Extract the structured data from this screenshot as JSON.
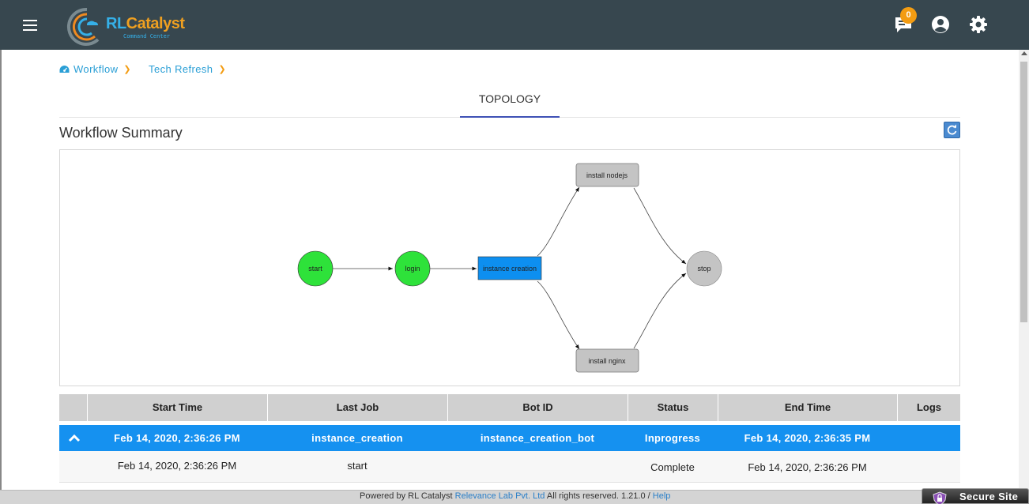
{
  "header": {
    "logo_text_rl": "RL",
    "logo_text_rest": "Catalyst",
    "logo_subtitle": "Command Center",
    "notification_count": "0",
    "colors": {
      "bar": "#37474f",
      "badge": "#f39c12"
    }
  },
  "breadcrumb": [
    {
      "label": "Workflow",
      "icon": "dashboard-icon"
    },
    {
      "label": "Tech Refresh"
    }
  ],
  "tabs": {
    "topology": "TOPOLOGY"
  },
  "summary": {
    "title": "Workflow Summary"
  },
  "graph": {
    "nodes": {
      "start": "start",
      "login": "login",
      "instance_creation": "instance creation",
      "install_nodejs": "install nodejs",
      "install_nginx": "install nginx",
      "stop": "stop"
    },
    "colors": {
      "complete": "#2ee23a",
      "active": "#0d8ff0",
      "pending": "#c4c4c4"
    }
  },
  "table": {
    "headers": [
      "Start Time",
      "Last Job",
      "Bot ID",
      "Status",
      "End Time",
      "Logs"
    ],
    "active_row": {
      "start_time": "Feb 14, 2020, 2:36:26 PM",
      "last_job": "instance_creation",
      "bot_id": "instance_creation_bot",
      "status": "Inprogress",
      "end_time": "Feb 14, 2020, 2:36:35 PM"
    },
    "rows": [
      {
        "start_time": "Feb 14, 2020, 2:36:26 PM",
        "last_job": "start",
        "bot_id": "",
        "status": "Complete",
        "end_time": "Feb 14, 2020, 2:36:26 PM"
      }
    ]
  },
  "footer": {
    "prefix": "Powered by RL Catalyst ",
    "company_link": "Relevance Lab Pvt. Ltd",
    "suffix": " All rights reserved. 1.21.0 / ",
    "help_link": "Help",
    "secure_badge": "Secure Site"
  }
}
